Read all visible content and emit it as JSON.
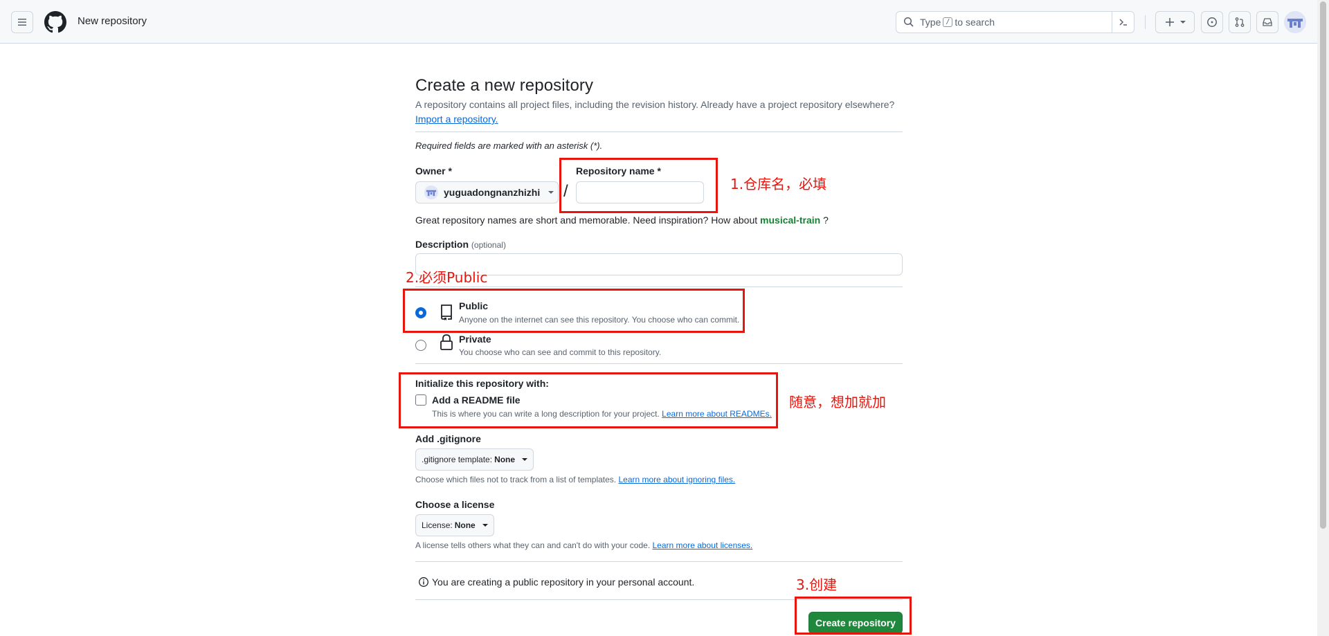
{
  "header": {
    "title": "New repository",
    "search_prefix": "Type",
    "search_key": "/",
    "search_suffix": "to search"
  },
  "page": {
    "title": "Create a new repository",
    "lead": "A repository contains all project files, including the revision history. Already have a project repository elsewhere?",
    "import_link": "Import a repository.",
    "required_note": "Required fields are marked with an asterisk (*).",
    "owner_label": "Owner *",
    "owner_value": "yuguadongnanzhizhi",
    "slash": "/",
    "repo_name_label": "Repository name *",
    "repo_name_value": "",
    "hint_prefix": "Great repository names are short and memorable. Need inspiration? How about",
    "hint_suggestion": "musical-train",
    "hint_suffix": "?",
    "description_label": "Description",
    "description_optional": "(optional)",
    "description_value": "",
    "visibility": {
      "public_title": "Public",
      "public_desc": "Anyone on the internet can see this repository. You choose who can commit.",
      "private_title": "Private",
      "private_desc": "You choose who can see and commit to this repository.",
      "selected": "public"
    },
    "init_label": "Initialize this repository with:",
    "readme_label": "Add a README file",
    "readme_desc": "This is where you can write a long description for your project.",
    "readme_link": "Learn more about READMEs.",
    "gitignore_label": "Add .gitignore",
    "gitignore_select_prefix": ".gitignore template:",
    "gitignore_select_value": "None",
    "gitignore_desc": "Choose which files not to track from a list of templates.",
    "gitignore_link": "Learn more about ignoring files.",
    "license_label": "Choose a license",
    "license_select_prefix": "License:",
    "license_select_value": "None",
    "license_desc": "A license tells others what they can and can't do with your code.",
    "license_link": "Learn more about licenses.",
    "info": "You are creating a public repository in your personal account.",
    "create_button": "Create repository"
  },
  "annotations": {
    "note1": "1.仓库名，必填",
    "note2": "2.必须Public",
    "note3": "随意，想加就加",
    "note4": "3.创建",
    "color": "#e8150d"
  },
  "colors": {
    "accent": "#0969da",
    "primary_button": "#1f883d",
    "suggestion": "#1a7f37"
  }
}
